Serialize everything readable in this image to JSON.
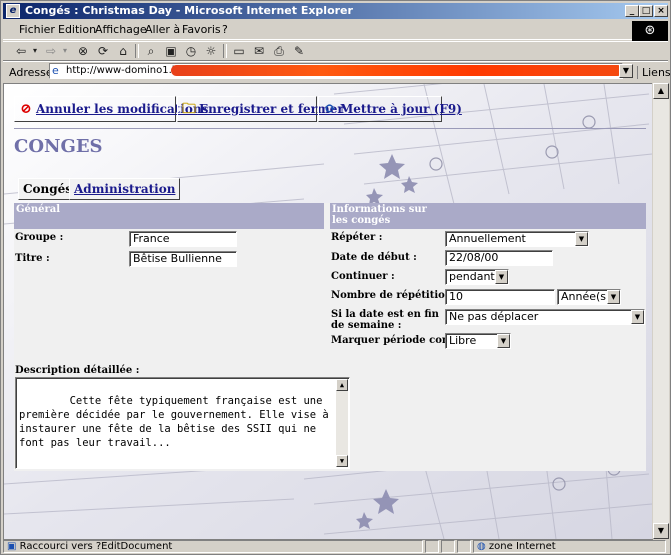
{
  "window": {
    "title": "Congés : Christmas Day - Microsoft Internet Explorer",
    "controls": {
      "minimize": "_",
      "maximize": "□",
      "close": "×"
    }
  },
  "menu": [
    "Fichier",
    "Edition",
    "Affichage",
    "Aller à",
    "Favoris",
    "?"
  ],
  "address": {
    "label": "Adresse",
    "url": "http://www-domino1.bull.fr/",
    "links_label": "Liens"
  },
  "actions": {
    "cancel": "Annuler les modifications",
    "save_close": "Enregistrer et fermer",
    "refresh": "Mettre à jour (F9)"
  },
  "page": {
    "title": "CONGES"
  },
  "tabs": {
    "conges": "Congés",
    "admin": "Administration"
  },
  "sections": {
    "general": "Général",
    "info": "Informations sur les congés"
  },
  "fields": {
    "groupe": {
      "label": "Groupe :",
      "value": "France"
    },
    "titre": {
      "label": "Titre :",
      "value": "Bêtise Bullienne"
    },
    "repeter": {
      "label": "Répéter :",
      "value": "Annuellement"
    },
    "date_debut": {
      "label": "Date de début :",
      "value": "22/08/00"
    },
    "continuer": {
      "label": "Continuer :",
      "value": "pendant"
    },
    "nb_repetitions": {
      "label": "Nombre de répétitions :",
      "value": "10",
      "unit": "Année(s)"
    },
    "fin_semaine": {
      "label": "Si la date est en fin de semaine :",
      "value": "Ne pas déplacer"
    },
    "periode": {
      "label": "Marquer période comme :",
      "value": "Libre"
    }
  },
  "description": {
    "label": "Description détaillée :",
    "text": "Cette fête typiquement française est une première décidée par le gouvernement. Elle vise à instaurer une fête de la bêtise des SSII qui ne font pas leur travail..."
  },
  "status": {
    "left": "Raccourci vers ?EditDocument",
    "zone": "zone Internet"
  },
  "colors": {
    "section_header": "#aaaac8",
    "link": "#1a1a8c",
    "title": "#6f6fa8"
  }
}
